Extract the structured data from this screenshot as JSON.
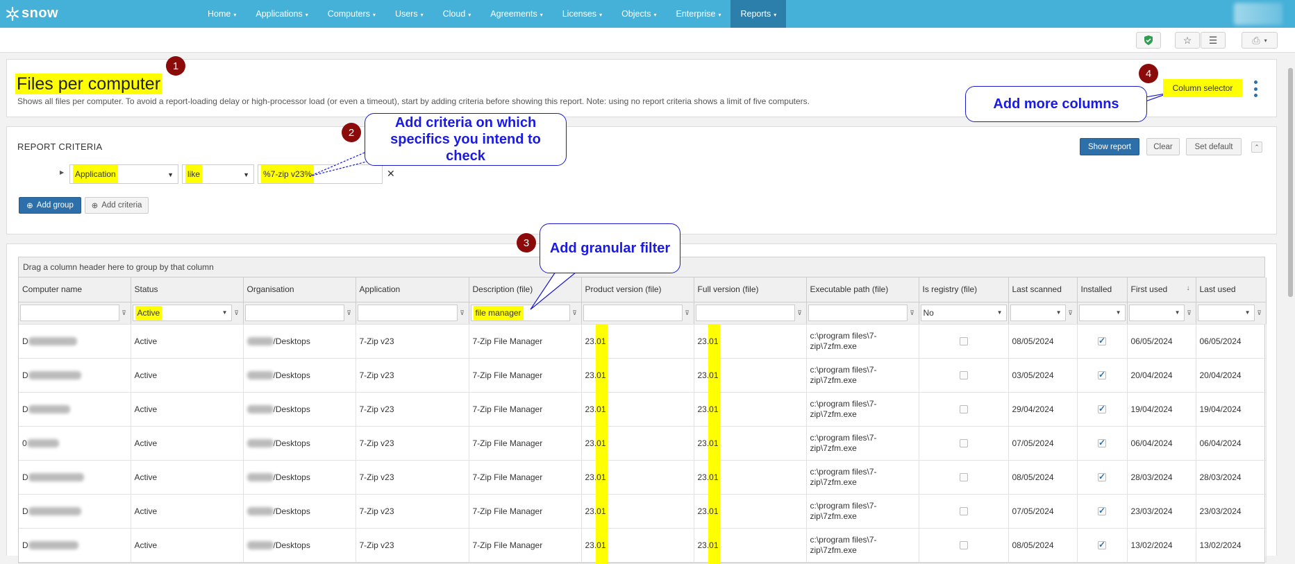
{
  "app": {
    "brand": "snow"
  },
  "nav": {
    "items": [
      {
        "label": "Home"
      },
      {
        "label": "Applications"
      },
      {
        "label": "Computers"
      },
      {
        "label": "Users"
      },
      {
        "label": "Cloud"
      },
      {
        "label": "Agreements"
      },
      {
        "label": "Licenses"
      },
      {
        "label": "Objects"
      },
      {
        "label": "Enterprise"
      },
      {
        "label": "Reports"
      }
    ],
    "active": "Reports"
  },
  "toolbar": {
    "icons": [
      "shield-check-icon",
      "star-icon",
      "checklist-icon",
      "print-icon"
    ]
  },
  "report": {
    "title": "Files per computer",
    "description": "Shows all files per computer. To avoid a report-loading delay or high-processor load (or even a timeout), start by adding criteria before showing this report. Note: using no report criteria shows a limit of five computers.",
    "column_selector": "Column selector"
  },
  "annotations": {
    "markers": [
      "1",
      "2",
      "3",
      "4"
    ],
    "callout_criteria": "Add criteria on which specifics you intend to check",
    "callout_filter": "Add granular filter",
    "callout_columns": "Add more columns"
  },
  "criteria": {
    "label": "REPORT CRITERIA",
    "field": "Application",
    "operator": "like",
    "value": "%7-zip v23%",
    "remove": "✕",
    "show_report": "Show report",
    "clear": "Clear",
    "set_default": "Set default",
    "add_group": "Add group",
    "add_criteria": "Add criteria"
  },
  "grid": {
    "group_hint": "Drag a column header here to group by that column",
    "columns": [
      "Computer name",
      "Status",
      "Organisation",
      "Application",
      "Description (file)",
      "Product version (file)",
      "Full version (file)",
      "Executable path (file)",
      "Is registry (file)",
      "Last scanned",
      "Installed",
      "First used",
      "Last used"
    ],
    "filters": {
      "status": "Active",
      "description": "file manager",
      "is_registry": "No"
    },
    "rows": [
      {
        "computer": "D",
        "status": "Active",
        "org": "/Desktops",
        "app": "7-Zip v23",
        "desc": "7-Zip File Manager",
        "pv": "23.01",
        "fv": "23.01",
        "path": "c:\\program files\\7-zip\\7zfm.exe",
        "registry": false,
        "last_scanned": "08/05/2024",
        "installed": true,
        "first_used": "06/05/2024",
        "last_used": "06/05/2024"
      },
      {
        "computer": "D",
        "status": "Active",
        "org": "/Desktops",
        "app": "7-Zip v23",
        "desc": "7-Zip File Manager",
        "pv": "23.01",
        "fv": "23.01",
        "path": "c:\\program files\\7-zip\\7zfm.exe",
        "registry": false,
        "last_scanned": "03/05/2024",
        "installed": true,
        "first_used": "20/04/2024",
        "last_used": "20/04/2024"
      },
      {
        "computer": "D",
        "status": "Active",
        "org": "/Desktops",
        "app": "7-Zip v23",
        "desc": "7-Zip File Manager",
        "pv": "23.01",
        "fv": "23.01",
        "path": "c:\\program files\\7-zip\\7zfm.exe",
        "registry": false,
        "last_scanned": "29/04/2024",
        "installed": true,
        "first_used": "19/04/2024",
        "last_used": "19/04/2024"
      },
      {
        "computer": "0",
        "status": "Active",
        "org": "/Desktops",
        "app": "7-Zip v23",
        "desc": "7-Zip File Manager",
        "pv": "23.01",
        "fv": "23.01",
        "path": "c:\\program files\\7-zip\\7zfm.exe",
        "registry": false,
        "last_scanned": "07/05/2024",
        "installed": true,
        "first_used": "06/04/2024",
        "last_used": "06/04/2024"
      },
      {
        "computer": "D",
        "status": "Active",
        "org": "/Desktops",
        "app": "7-Zip v23",
        "desc": "7-Zip File Manager",
        "pv": "23.01",
        "fv": "23.01",
        "path": "c:\\program files\\7-zip\\7zfm.exe",
        "registry": false,
        "last_scanned": "08/05/2024",
        "installed": true,
        "first_used": "28/03/2024",
        "last_used": "28/03/2024"
      },
      {
        "computer": "D",
        "status": "Active",
        "org": "/Desktops",
        "app": "7-Zip v23",
        "desc": "7-Zip File Manager",
        "pv": "23.01",
        "fv": "23.01",
        "path": "c:\\program files\\7-zip\\7zfm.exe",
        "registry": false,
        "last_scanned": "07/05/2024",
        "installed": true,
        "first_used": "23/03/2024",
        "last_used": "23/03/2024"
      },
      {
        "computer": "D",
        "status": "Active",
        "org": "/Desktops",
        "app": "7-Zip v23",
        "desc": "7-Zip File Manager",
        "pv": "23.01",
        "fv": "23.01",
        "path": "c:\\program files\\7-zip\\7zfm.exe",
        "registry": false,
        "last_scanned": "08/05/2024",
        "installed": true,
        "first_used": "13/02/2024",
        "last_used": "13/02/2024"
      }
    ]
  },
  "colors": {
    "nav": "#45b0d8",
    "nav_active": "#2d7fab",
    "highlight": "#ffff00",
    "marker": "#8b0a0a",
    "callout_text": "#1a1ae6",
    "primary": "#2d6fa8"
  }
}
